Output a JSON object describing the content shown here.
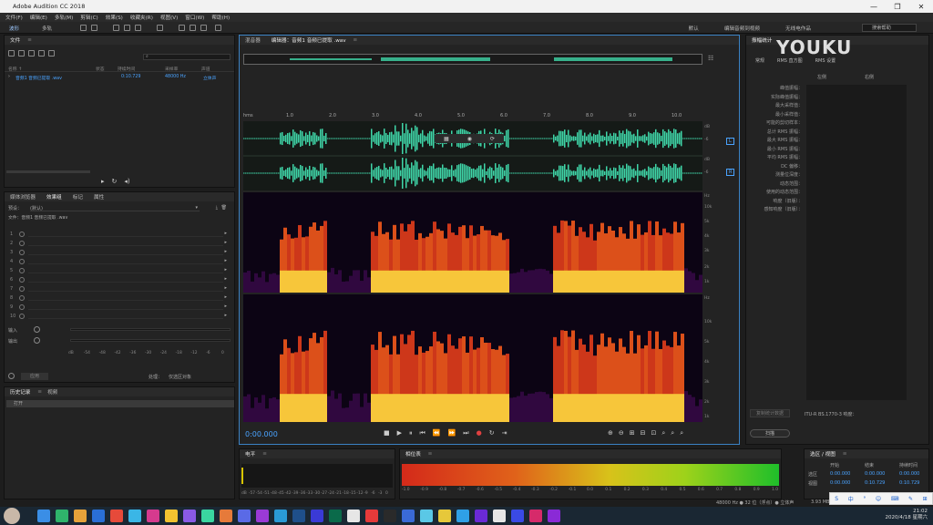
{
  "window": {
    "title": "Adobe Audition CC 2018"
  },
  "menu": [
    "文件(F)",
    "编辑(E)",
    "多轨(M)",
    "剪辑(C)",
    "效果(S)",
    "收藏夹(R)",
    "视图(V)",
    "窗口(W)",
    "帮助(H)"
  ],
  "toolbar": {
    "waveform": "波形",
    "multitrack": "多轨"
  },
  "workspaces": [
    "默认",
    "编辑音频到视频",
    "无线电作品"
  ],
  "search_help": "搜索帮助",
  "watermark": "YOUKU",
  "files": {
    "tab": "文件",
    "columns": [
      "名称 ↑",
      "状态",
      "持续时间",
      "采样率",
      "声道"
    ],
    "row": {
      "name": "音频1 音频已提取 .wav",
      "duration": "0:10.729",
      "rate": "48000 Hz",
      "channels": "立体声"
    }
  },
  "effects": {
    "tabs": [
      "媒体浏览器",
      "效果组",
      "标记",
      "属性"
    ],
    "preset_label": "预设：",
    "preset_value": "(默认)",
    "file_label": "文件：音频1 音频已提取 .wav",
    "slots": [
      "1",
      "2",
      "3",
      "4",
      "5",
      "6",
      "7",
      "8",
      "9",
      "10"
    ],
    "input_label": "输入",
    "output_label": "输出",
    "apply_label": "应用",
    "process_label": "处理：",
    "process_value": "仅选区对象",
    "meter_ticks": [
      "dB",
      "-54",
      "-48",
      "-42",
      "-36",
      "-30",
      "-24",
      "-18",
      "-12",
      "-6",
      "0"
    ]
  },
  "history": {
    "tabs": [
      "历史记录",
      "视频"
    ],
    "item": "打开"
  },
  "editor": {
    "tabs": [
      "混音器",
      "编辑器：音频1 音频已提取 .wav"
    ],
    "ruler": [
      "hms",
      "1.0",
      "2.0",
      "3.0",
      "4.0",
      "5.0",
      "6.0",
      "7.0",
      "8.0",
      "9.0",
      "10.0"
    ],
    "db_top": [
      "dB",
      "-6",
      "dB",
      "-6"
    ],
    "hz_top": [
      "Hz",
      "10k",
      "5k",
      "4k",
      "3k",
      "2k",
      "1k"
    ],
    "hz_bottom": [
      "Hz",
      "10k",
      "5k",
      "4k",
      "3k",
      "2k",
      "1k"
    ],
    "channel_l": "L",
    "channel_r": "R",
    "timecode": "0:00.000"
  },
  "properties": {
    "tab": "振幅统计",
    "subtabs": [
      "常规",
      "RMS 直方图",
      "RMS 设置"
    ],
    "cols": [
      "左侧",
      "右侧"
    ],
    "labels": [
      "峰值振幅：",
      "实际峰值振幅：",
      "最大采样值：",
      "最小采样值：",
      "可能的剪切样本：",
      "总计 RMS 振幅：",
      "最大 RMS 振幅：",
      "最小 RMS 振幅：",
      "平均 RMS 振幅：",
      "DC 偏移：",
      "测量位深度：",
      "动态范围：",
      "使用的动态范围：",
      "响度（旧版）：",
      "感知响度（旧版）："
    ],
    "itu": "ITU-R BS.1770-3 响度：",
    "copy_button": "复制统计数据",
    "scan_button": "扫描"
  },
  "levels": {
    "tab": "电平",
    "ticks": [
      "dB",
      "-57",
      "-54",
      "-51",
      "-48",
      "-45",
      "-42",
      "-39",
      "-36",
      "-33",
      "-30",
      "-27",
      "-24",
      "-21",
      "-18",
      "-15",
      "-12",
      "-9",
      "-6",
      "-3",
      "0"
    ]
  },
  "phase": {
    "tab": "相位表",
    "ticks": [
      "-1.0",
      "-0.9",
      "-0.8",
      "-0.7",
      "-0.6",
      "-0.5",
      "-0.4",
      "-0.3",
      "-0.2",
      "-0.1",
      "0.0",
      "0.1",
      "0.2",
      "0.3",
      "0.4",
      "0.5",
      "0.6",
      "0.7",
      "0.8",
      "0.9",
      "1.0"
    ]
  },
  "selection": {
    "tab": "选区 / 视图",
    "cols": [
      "开始",
      "结束",
      "持续时间"
    ],
    "rows": [
      {
        "label": "选区",
        "start": "0:00.000",
        "end": "0:00.000",
        "dur": "0:00.000"
      },
      {
        "label": "视图",
        "start": "0:00.000",
        "end": "0:10.729",
        "dur": "0:10.729"
      }
    ]
  },
  "status": {
    "format": "48000 Hz ● 32 位（浮点）● 立体声",
    "size": "3.93 MB"
  },
  "clock": {
    "time": "21:02",
    "date": "2020/4/18 星期六"
  },
  "ime": [
    "S",
    "中",
    "°",
    "☺",
    "⌨",
    "✎",
    "⊞"
  ],
  "colors": {
    "accent": "#4aa3ff",
    "wave": "#3fd6a8",
    "editor_border": "#3b82c4"
  }
}
